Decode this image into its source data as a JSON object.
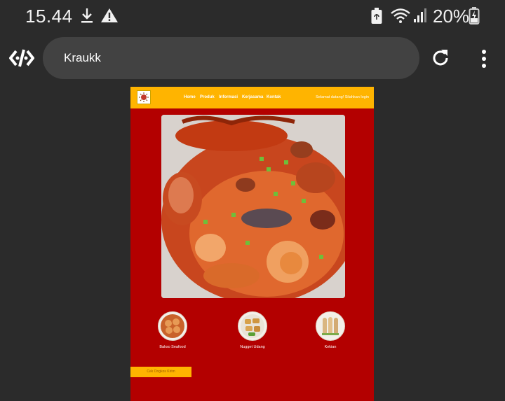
{
  "status_bar": {
    "time": "15.44",
    "battery": "20%"
  },
  "browser": {
    "address": "Kraukk"
  },
  "site": {
    "nav_links": [
      "Home",
      "Produk",
      "Informasi",
      "Kerjasama",
      "Kontak"
    ],
    "welcome": "Selamat datang! Silahkan login",
    "products": [
      {
        "name": "Bakso Seafood"
      },
      {
        "name": "Nugget Udang"
      },
      {
        "name": "Kekian"
      }
    ],
    "cta_label": "Cek Ongkos Kirim"
  },
  "colors": {
    "page_background": "#b30000",
    "nav_background": "#ffb400",
    "browser_background": "#2b2b2b"
  }
}
